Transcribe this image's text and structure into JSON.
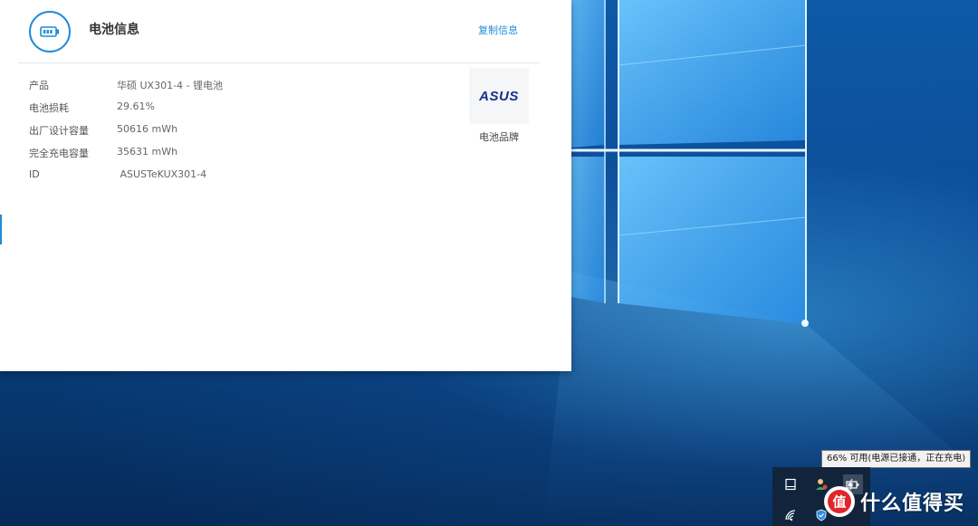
{
  "panel": {
    "title": "电池信息",
    "copy_label": "复制信息",
    "rows": [
      {
        "label": "产品",
        "value": "华硕 UX301-4 -   锂电池"
      },
      {
        "label": "电池损耗",
        "value": "29.61%"
      },
      {
        "label": "出厂设计容量",
        "value": "50616 mWh"
      },
      {
        "label": "完全充电容量",
        "value": "35631 mWh"
      },
      {
        "label": "ID",
        "value": " ASUSTeKUX301-4"
      }
    ],
    "brand_logo_text": "ASUS",
    "brand_caption": "电池品牌"
  },
  "tooltip": "66% 可用(电源已接通，正在充电)",
  "tray": {
    "icons": [
      "tablet-icon",
      "user-app-icon",
      "battery-charging-icon",
      "wifi-icon",
      "shield-icon"
    ]
  },
  "watermark": {
    "text": "什么值得买",
    "logo_char": "值"
  },
  "colors": {
    "accent": "#1f8bd8",
    "asus_logo": "#1a2f8c",
    "tray_bg": "#14233a",
    "wm_logo": "#e0262b"
  }
}
